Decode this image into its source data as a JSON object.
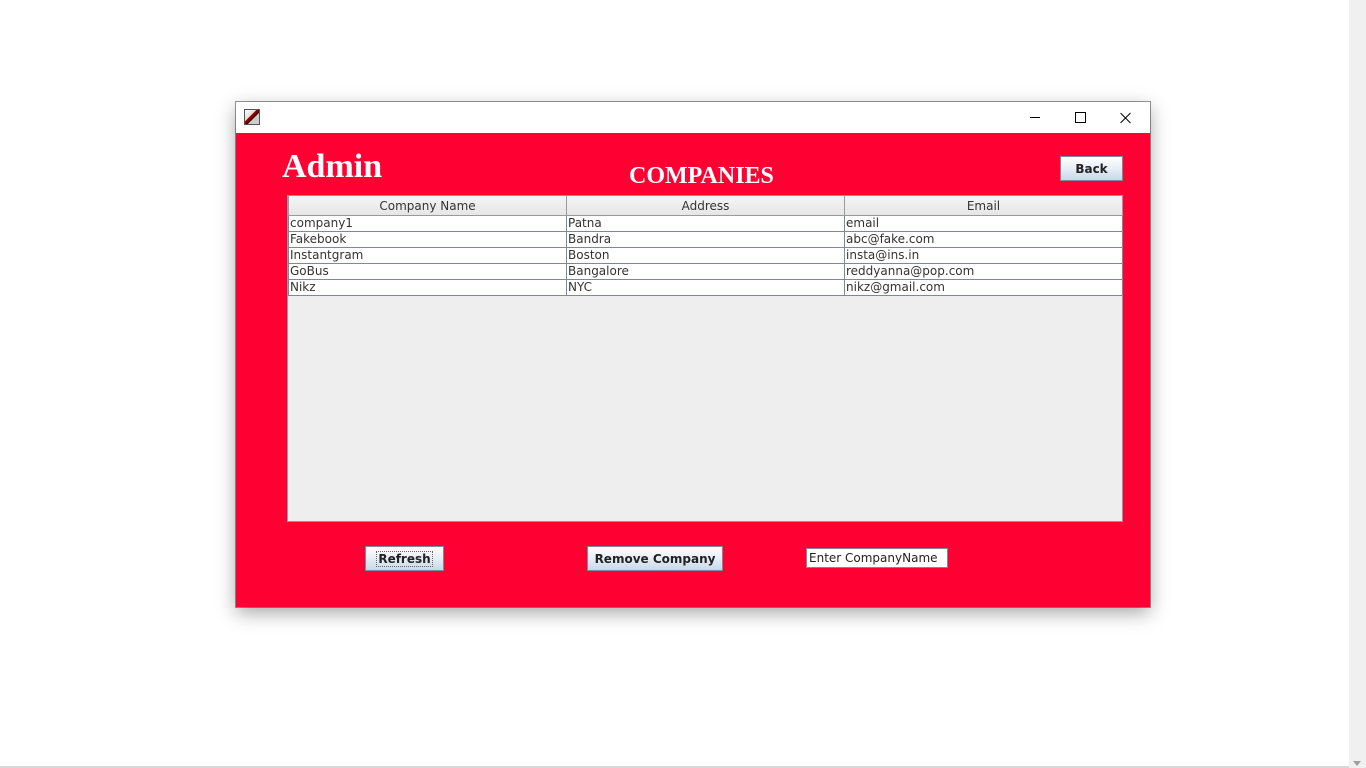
{
  "window": {
    "app_icon": "java-app-icon",
    "controls": {
      "minimize": "minimize-icon",
      "maximize": "maximize-icon",
      "close": "close-icon"
    }
  },
  "header": {
    "admin_title": "Admin",
    "page_title": "COMPANIES",
    "back_label": "Back"
  },
  "table": {
    "columns": [
      "Company Name",
      "Address",
      "Email"
    ],
    "rows": [
      [
        "company1",
        "Patna",
        "email"
      ],
      [
        "Fakebook",
        "Bandra",
        "abc@fake.com"
      ],
      [
        "Instantgram",
        "Boston",
        "insta@ins.in"
      ],
      [
        "GoBus",
        "Bangalore",
        "reddyanna@pop.com"
      ],
      [
        "Nikz",
        "NYC",
        "nikz@gmail.com"
      ]
    ]
  },
  "actions": {
    "refresh_label": "Refresh",
    "remove_label": "Remove Company",
    "company_input_value": "Enter CompanyName"
  },
  "colors": {
    "window_background": "#ff0033",
    "title_text": "#ffffff"
  }
}
